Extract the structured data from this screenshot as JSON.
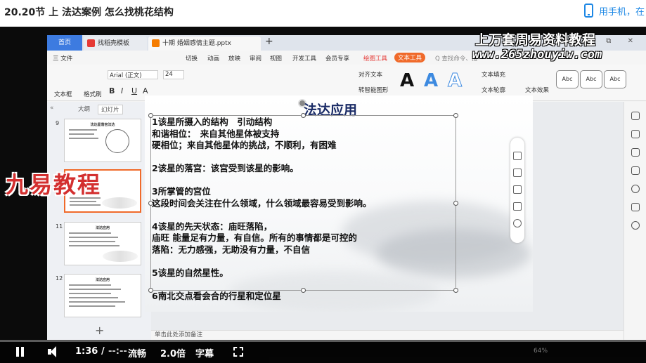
{
  "page": {
    "title": "20.20节 上 法达案例 怎么找桃花结构",
    "phone_link": "用手机，在"
  },
  "wps": {
    "tabs": {
      "home": "首页",
      "tab1": "找稻壳模板",
      "tab2": "十期 婚姻感情主题.pptx"
    },
    "menu": {
      "file": "三 文件",
      "items": [
        "切换",
        "动画",
        "放映",
        "审阅",
        "视图",
        "开发工具",
        "会员专享"
      ],
      "drawing_tools": "绘图工具",
      "text_tools": "文本工具",
      "search": "Q 查找命令、搜"
    },
    "ribbon": {
      "textbox": "文本框",
      "format_brush": "格式刷",
      "font": "Arial (正文)",
      "size": "24",
      "align_text": "对齐文本",
      "smartart": "转智能图形",
      "fill": "文本填充",
      "outline": "文本轮廓",
      "effects": "文本效果",
      "styles": [
        "Abc",
        "Abc",
        "Abc"
      ]
    },
    "panel": {
      "outline": "大纲",
      "slides": "幻灯片",
      "thumbs": [
        {
          "num": "9",
          "title": "法达星落宫法达"
        },
        {
          "num": "",
          "title": ""
        },
        {
          "num": "11",
          "title": "法达应用"
        },
        {
          "num": "12",
          "title": "法达应用"
        }
      ]
    },
    "notes": "单击此处添加备注"
  },
  "slide": {
    "title": "法达应用",
    "lines": [
      "1该星所摄入的结构　引动结构",
      "和谐相位：　来自其他星体被支持",
      "硬相位；来自其他星体的挑战，不顺利，有困难",
      "",
      "2该星的落宫：该宫受到该星的影响。",
      "",
      "3所掌管的宫位",
      "这段时间会关注在什么领域，什么领域最容易受到影响。",
      "",
      "4该星的先天状态：庙旺落陷，",
      "庙旺 能量足有力量，有自信。所有的事情都是可控的",
      "落陷：无力感强，无助没有力量，不自信",
      "",
      "5该星的自然星性。",
      "",
      "6南北交点看会合的行星和定位星"
    ]
  },
  "watermarks": {
    "top": "上万套周易资料教程",
    "url": "www.265zhouyiw.com",
    "logo": "九易教程"
  },
  "player": {
    "time": "1:36",
    "separator": "/",
    "duration": "--:--",
    "quality": "流畅",
    "speed": "2.0倍",
    "subtitle": "字幕",
    "progress": 0.0,
    "zoom": "64%"
  }
}
